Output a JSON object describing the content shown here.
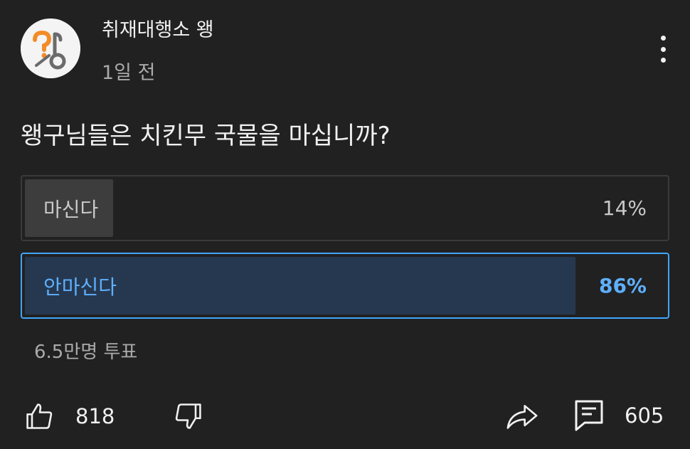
{
  "post": {
    "channel_name": "취재대행소 왱",
    "time": "1일 전",
    "question": "왱구님들은 치킨무 국물을 마십니까?"
  },
  "poll": {
    "options": [
      {
        "label": "마신다",
        "percent": "14%",
        "value": 14,
        "selected": false
      },
      {
        "label": "안마신다",
        "percent": "86%",
        "value": 86,
        "selected": true
      }
    ],
    "vote_count": "6.5만명 투표"
  },
  "actions": {
    "like_count": "818",
    "comment_count": "605"
  },
  "colors": {
    "background": "#212121",
    "accent": "#3ea6ff",
    "selected_fill": "#263850",
    "unselected_fill": "#3d3d3d"
  },
  "icons": [
    "channel-avatar",
    "more-vert-icon",
    "thumbs-up-icon",
    "thumbs-down-icon",
    "share-icon",
    "comment-icon"
  ]
}
